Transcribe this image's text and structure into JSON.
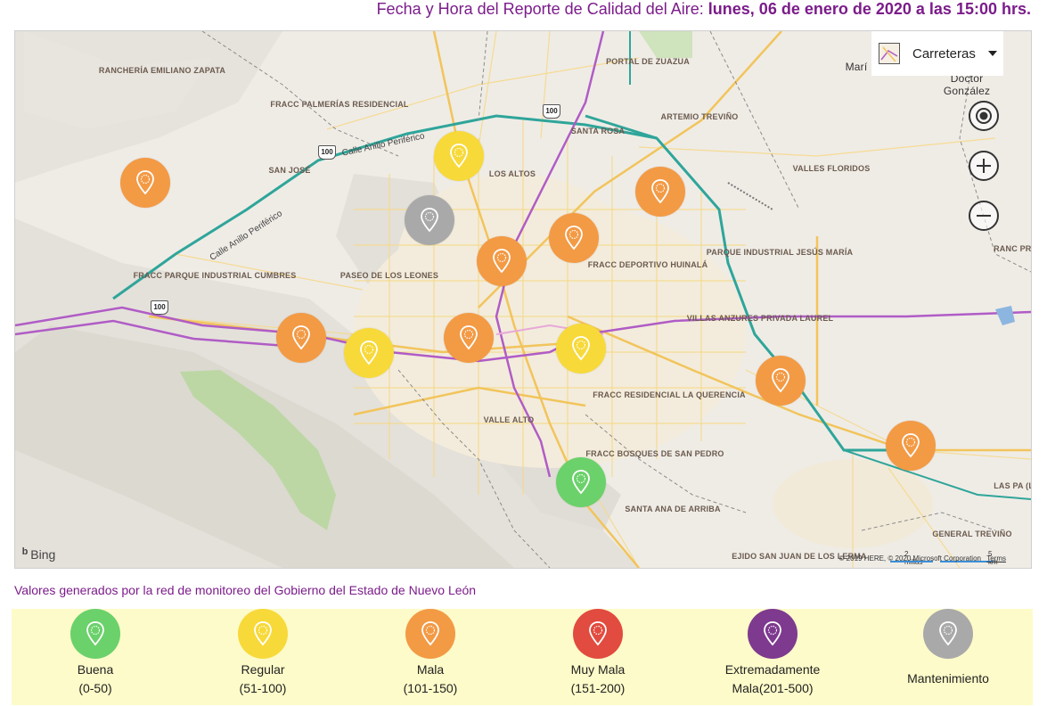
{
  "header": {
    "prefix": "Fecha y Hora del Reporte de Calidad del Aire:",
    "datetime": "lunes, 06 de enero de 2020 a las 15:00 hrs."
  },
  "map": {
    "map_type_label": "Carreteras",
    "colors": {
      "buena": "#6bd16b",
      "regular": "#f7d93a",
      "mala": "#f39a45",
      "muy_mala": "#e24b3f",
      "extremadamente_mala": "#7e3a8f",
      "mantenimiento": "#a9a9a9"
    },
    "places": [
      {
        "text": "RANCHERÍA EMILIANO ZAPATA"
      },
      {
        "text": "PORTAL DE ZUAZUA"
      },
      {
        "text": "FRACC PALMERÍAS RESIDENCIAL"
      },
      {
        "text": "ARTEMIO TREVIÑO"
      },
      {
        "text": "SANTA ROSA"
      },
      {
        "text": "SAN JOSÉ"
      },
      {
        "text": "LOS ALTOS"
      },
      {
        "text": "VALLES FLORIDOS"
      },
      {
        "text": "FRACC PARQUE INDUSTRIAL CUMBRES"
      },
      {
        "text": "PASEO DE LOS LEONES"
      },
      {
        "text": "FRACC DEPORTIVO HUINALÁ"
      },
      {
        "text": "PARQUE INDUSTRIAL JESÚS MARÍA"
      },
      {
        "text": "VILLAS ANZURES PRIVADA LAUREL"
      },
      {
        "text": "FRACC RESIDENCIAL LA QUERENCIA"
      },
      {
        "text": "VALLE ALTO"
      },
      {
        "text": "FRACC BOSQUES DE SAN PEDRO"
      },
      {
        "text": "SANTA ANA DE ARRIBA"
      },
      {
        "text": "EJIDO SAN JUAN DE LOS LERMA"
      },
      {
        "text": "GENERAL TREVIÑO"
      },
      {
        "text": "LAS PA (LA F"
      },
      {
        "text": "RANC PROV"
      }
    ],
    "big_places": [
      {
        "text": "Marí"
      },
      {
        "text": "Doctor González"
      }
    ],
    "road_labels": [
      {
        "text": "Calle Anillo Periférico"
      },
      {
        "text": "Calle Anillo Periférico"
      }
    ],
    "shields": [
      "100",
      "100",
      "100"
    ],
    "stations": [
      {
        "status": "mala"
      },
      {
        "status": "regular"
      },
      {
        "status": "mantenimiento"
      },
      {
        "status": "mala"
      },
      {
        "status": "mala"
      },
      {
        "status": "mala"
      },
      {
        "status": "mala"
      },
      {
        "status": "regular"
      },
      {
        "status": "mala"
      },
      {
        "status": "regular"
      },
      {
        "status": "mala"
      },
      {
        "status": "mala"
      },
      {
        "status": "buena"
      }
    ],
    "attribution": {
      "bing": "Bing",
      "scale_miles": "2 millas",
      "scale_km": "5 km",
      "copyright": "© 2019 HERE, © 2020 Microsoft Corporation",
      "terms": "Terms"
    }
  },
  "note": "Valores generados por la red de monitoreo del Gobierno del Estado de Nuevo León",
  "legend": [
    {
      "status": "buena",
      "line1": "Buena",
      "line2": "(0-50)"
    },
    {
      "status": "regular",
      "line1": "Regular",
      "line2": "(51-100)"
    },
    {
      "status": "mala",
      "line1": "Mala",
      "line2": "(101-150)"
    },
    {
      "status": "muy_mala",
      "line1": "Muy Mala",
      "line2": "(151-200)"
    },
    {
      "status": "extremadamente_mala",
      "line1": "Extremadamente",
      "line2": "Mala(201-500)"
    },
    {
      "status": "mantenimiento",
      "line1": "Mantenimiento",
      "line2": ""
    }
  ]
}
